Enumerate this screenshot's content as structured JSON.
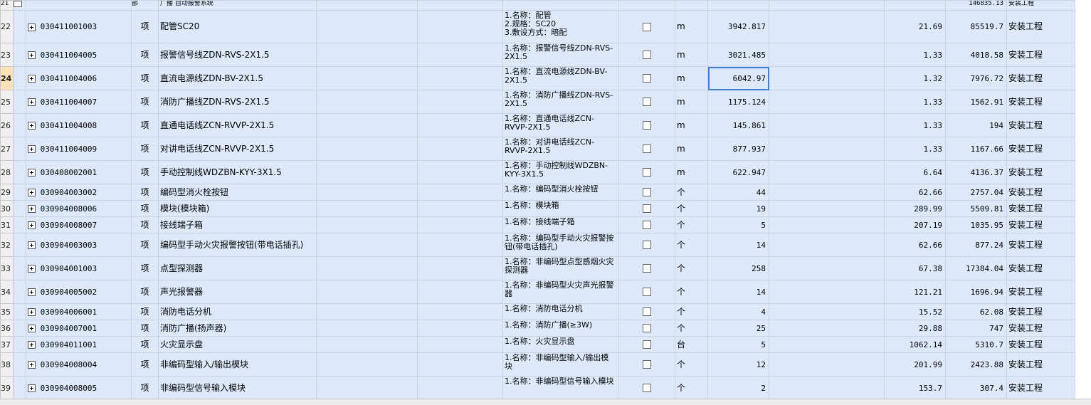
{
  "header_row": {
    "row_no": "21",
    "name": "广播 自动报警系统",
    "amount": "146835.13",
    "category": "安装工程"
  },
  "rows": [
    {
      "no": "22",
      "code": "030411001003",
      "type": "项",
      "name": "配管SC20",
      "feature": "1.名称：配管\n2.规格：SC20\n3.敷设方式：暗配",
      "unit": "m",
      "qty": "3942.817",
      "price": "21.69",
      "total": "85519.7",
      "category": "安装工程",
      "h": 46
    },
    {
      "no": "23",
      "code": "030411004005",
      "type": "项",
      "name": "报警信号线ZDN-RVS-2X1.5",
      "feature": "1.名称：报警信号线ZDN-RVS-2X1.5",
      "unit": "m",
      "qty": "3021.485",
      "price": "1.33",
      "total": "4018.58",
      "category": "安装工程",
      "h": 33
    },
    {
      "no": "24",
      "code": "030411004006",
      "type": "项",
      "name": "直流电源线ZDN-BV-2X1.5",
      "feature": "1.名称：直流电源线ZDN-BV-2X1.5",
      "unit": "m",
      "qty": "6042.97",
      "price": "1.32",
      "total": "7976.72",
      "category": "安装工程",
      "h": 33,
      "active": true
    },
    {
      "no": "25",
      "code": "030411004007",
      "type": "项",
      "name": "消防广播线ZDN-RVS-2X1.5",
      "feature": "1.名称：消防广播线ZDN-RVS-2X1.5",
      "unit": "m",
      "qty": "1175.124",
      "price": "1.33",
      "total": "1562.91",
      "category": "安装工程",
      "h": 33
    },
    {
      "no": "26",
      "code": "030411004008",
      "type": "项",
      "name": "直通电话线ZCN-RVVP-2X1.5",
      "feature": "1.名称：直通电话线ZCN-RVVP-2X1.5",
      "unit": "m",
      "qty": "145.861",
      "price": "1.33",
      "total": "194",
      "category": "安装工程",
      "h": 33
    },
    {
      "no": "27",
      "code": "030411004009",
      "type": "项",
      "name": "对讲电话线ZCN-RVVP-2X1.5",
      "feature": "1.名称：对讲电话线ZCN-RVVP-2X1.5",
      "unit": "m",
      "qty": "877.937",
      "price": "1.33",
      "total": "1167.66",
      "category": "安装工程",
      "h": 33
    },
    {
      "no": "28",
      "code": "030408002001",
      "type": "项",
      "name": "手动控制线WDZBN-KYY-3X1.5",
      "feature": "1.名称：手动控制线WDZBN-KYY-3X1.5",
      "unit": "m",
      "qty": "622.947",
      "price": "6.64",
      "total": "4136.37",
      "category": "安装工程",
      "h": 33
    },
    {
      "no": "29",
      "code": "030904003002",
      "type": "项",
      "name": "编码型消火栓按钮",
      "feature": "1.名称：编码型消火栓按钮",
      "unit": "个",
      "qty": "44",
      "price": "62.66",
      "total": "2757.04",
      "category": "安装工程",
      "h": 23
    },
    {
      "no": "30",
      "code": "030904008006",
      "type": "项",
      "name": "模块(模块箱)",
      "feature": "1.名称：模块箱",
      "unit": "个",
      "qty": "19",
      "price": "289.99",
      "total": "5509.81",
      "category": "安装工程",
      "h": 23
    },
    {
      "no": "31",
      "code": "030904008007",
      "type": "项",
      "name": "接线端子箱",
      "feature": "1.名称：接线端子箱",
      "unit": "个",
      "qty": "5",
      "price": "207.19",
      "total": "1035.95",
      "category": "安装工程",
      "h": 23
    },
    {
      "no": "32",
      "code": "030904003003",
      "type": "项",
      "name": "编码型手动火灾报警按钮(带电话插孔)",
      "feature": "1.名称：编码型手动火灾报警按钮(带电话插孔)",
      "unit": "个",
      "qty": "14",
      "price": "62.66",
      "total": "877.24",
      "category": "安装工程",
      "h": 33
    },
    {
      "no": "33",
      "code": "030904001003",
      "type": "项",
      "name": "点型探测器",
      "feature": "1.名称：非编码型点型感烟火灾探测器",
      "unit": "个",
      "qty": "258",
      "price": "67.38",
      "total": "17384.04",
      "category": "安装工程",
      "h": 33
    },
    {
      "no": "34",
      "code": "030904005002",
      "type": "项",
      "name": "声光报警器",
      "feature": "1.名称：非编码型火灾声光报警器",
      "unit": "个",
      "qty": "14",
      "price": "121.21",
      "total": "1696.94",
      "category": "安装工程",
      "h": 33
    },
    {
      "no": "35",
      "code": "030904006001",
      "type": "项",
      "name": "消防电话分机",
      "feature": "1.名称：消防电话分机",
      "unit": "个",
      "qty": "4",
      "price": "15.52",
      "total": "62.08",
      "category": "安装工程",
      "h": 23
    },
    {
      "no": "36",
      "code": "030904007001",
      "type": "项",
      "name": "消防广播(扬声器)",
      "feature": "1.名称：消防广播(≥3W)",
      "unit": "个",
      "qty": "25",
      "price": "29.88",
      "total": "747",
      "category": "安装工程",
      "h": 23
    },
    {
      "no": "37",
      "code": "030904011001",
      "type": "项",
      "name": "火灾显示盘",
      "feature": "1.名称：火灾显示盘",
      "unit": "台",
      "qty": "5",
      "price": "1062.14",
      "total": "5310.7",
      "category": "安装工程",
      "h": 23
    },
    {
      "no": "38",
      "code": "030904008004",
      "type": "项",
      "name": "非编码型输入/输出模块",
      "feature": "1.名称：非编码型输入/输出模块",
      "unit": "个",
      "qty": "12",
      "price": "201.99",
      "total": "2423.88",
      "category": "安装工程",
      "h": 33
    },
    {
      "no": "39",
      "code": "030904008005",
      "type": "项",
      "name": "非编码型信号输入模块",
      "feature": "1.名称：非编码型信号输入模块",
      "unit": "个",
      "qty": "2",
      "price": "153.7",
      "total": "307.4",
      "category": "安装工程",
      "h": 33
    }
  ],
  "icons": {
    "expand": "plus-box-icon",
    "checkbox": "checkbox-icon"
  },
  "colors": {
    "row_bg": "#dde9fb",
    "grid_line": "#c9d3e0",
    "active_row_no": "#fde1b8",
    "selection": "#3f7fd4"
  }
}
